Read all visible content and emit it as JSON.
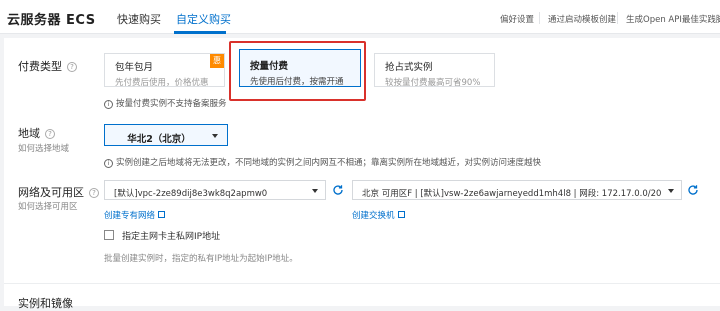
{
  "header": {
    "title": "云服务器 ECS",
    "tabs": [
      {
        "label": "快速购买"
      },
      {
        "label": "自定义购买"
      }
    ],
    "links": [
      "偏好设置",
      "通过启动模板创建",
      "生成Open API最佳实践脚本"
    ]
  },
  "billing": {
    "label": "付费类型",
    "options": [
      {
        "title": "包年包月",
        "desc": "先付费后使用，价格优惠",
        "badge": "惠"
      },
      {
        "title": "按量付费",
        "desc": "先使用后付费，按需开通"
      },
      {
        "title": "抢占式实例",
        "desc": "较按量付费最高可省90%"
      }
    ],
    "note": "按量付费实例不支持备案服务"
  },
  "region": {
    "label": "地域",
    "sublabel": "如何选择地域",
    "selected": "华北2（北京）",
    "note": "实例创建之后地域将无法更改，不同地域的实例之间内网互不相通；靠离实例所在地域越近，对实例访问速度越快"
  },
  "network": {
    "label": "网络及可用区",
    "sublabel": "如何选择可用区",
    "vpc_value": "[默认]vpc-2ze89dij8e3wk8q2apmw0",
    "vswitch_value": "北京 可用区F | [默认]vsw-2ze6awjarneyedd1mh4l8 | 网段: 172.17.0.0/20",
    "create_vpc": "创建专有网络",
    "create_vswitch": "创建交换机",
    "checkbox_label": "指定主网卡主私网IP地址",
    "hint": "批量创建实例时，指定的私有IP地址为起始IP地址。"
  },
  "next_section": {
    "label": "实例和镜像"
  },
  "colors": {
    "accent": "#0070cc",
    "highlight": "#d9312b",
    "badge": "#ff8a00"
  }
}
